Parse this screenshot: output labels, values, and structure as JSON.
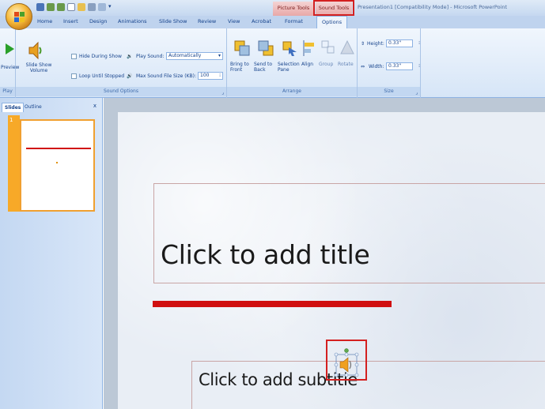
{
  "titlebar": {
    "qat_icons": [
      "save-icon",
      "undo-icon",
      "redo-icon",
      "new-icon",
      "open-icon",
      "print-icon",
      "preview-icon",
      "customize-icon"
    ],
    "context_picture_tools": "Picture Tools",
    "context_sound_tools": "Sound Tools",
    "window_title": "Presentation1 [Compatibility Mode] - Microsoft PowerPoint"
  },
  "tabs": [
    "Home",
    "Insert",
    "Design",
    "Animations",
    "Slide Show",
    "Review",
    "View",
    "Acrobat",
    "Format",
    "Options"
  ],
  "ribbon": {
    "play": {
      "preview_label": "Preview",
      "group_label": "Play"
    },
    "sound_options": {
      "slide_show_volume": "Slide Show Volume",
      "hide_during_show": "Hide During Show",
      "loop_until_stopped": "Loop Until Stopped",
      "play_sound_label": "Play Sound:",
      "play_sound_value": "Automatically",
      "max_sound_label": "Max Sound File Size (KB):",
      "max_sound_value": "100",
      "group_label": "Sound Options"
    },
    "arrange": {
      "bring_to_front": "Bring to Front",
      "send_to_back": "Send to Back",
      "selection_pane": "Selection Pane",
      "align": "Align",
      "group": "Group",
      "rotate": "Rotate",
      "group_label": "Arrange"
    },
    "size": {
      "height_label": "Height:",
      "height_value": "0.33\"",
      "width_label": "Width:",
      "width_value": "0.33\"",
      "group_label": "Size"
    }
  },
  "panel": {
    "tab_slides": "Slides",
    "tab_outline": "Outline",
    "close": "x",
    "slide_number": "1"
  },
  "slide": {
    "title_placeholder": "Click to add title",
    "subtitle_placeholder": "Click to add subtitle"
  },
  "colors": {
    "accent_red": "#d00f10",
    "highlight_red": "#d42020",
    "ribbon_blue": "#15428b"
  }
}
